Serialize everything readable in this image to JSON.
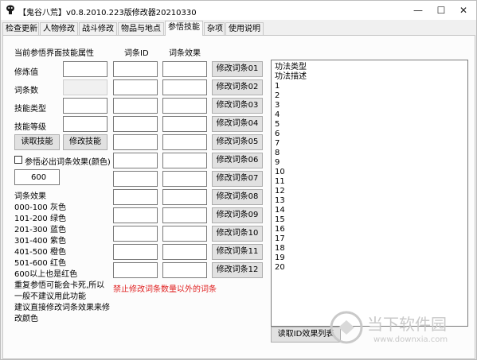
{
  "window": {
    "title": "【鬼谷八荒】v0.8.2010.223版修改器20210330",
    "minimize_glyph": "—",
    "maximize_glyph": "☐",
    "close_glyph": "✕",
    "icon": "app-icon"
  },
  "tabs": [
    {
      "label": "检查更新"
    },
    {
      "label": "人物修改"
    },
    {
      "label": "战斗修改"
    },
    {
      "label": "物品与地点"
    },
    {
      "label": "参悟技能"
    },
    {
      "label": "杂项"
    },
    {
      "label": "使用说明"
    }
  ],
  "active_tab": "参悟技能",
  "section": {
    "heading": "当前参悟界面技能属性",
    "col_id_header": "词条ID",
    "col_effect_header": "词条效果"
  },
  "fields": [
    {
      "label": "修炼值",
      "value": ""
    },
    {
      "label": "词条数",
      "value": ""
    },
    {
      "label": "技能类型",
      "value": ""
    },
    {
      "label": "技能等级",
      "value": ""
    }
  ],
  "buttons": {
    "read_skill": "读取技能",
    "modify_skill": "修改技能",
    "read_id_list": "读取ID效果列表"
  },
  "entry_buttons": [
    "修改词条01",
    "修改词条02",
    "修改词条03",
    "修改词条04",
    "修改词条05",
    "修改词条06",
    "修改词条07",
    "修改词条08",
    "修改词条09",
    "修改词条10",
    "修改词条11",
    "修改词条12"
  ],
  "checkbox": {
    "label": "参悟必出词条效果(颜色)",
    "checked": false
  },
  "effect_value": "600",
  "legend": {
    "title": "词条效果",
    "lines": [
      "000-100 灰色",
      "101-200 绿色",
      "201-300 蓝色",
      "301-400 紫色",
      "401-500 橙色",
      "501-600 红色",
      "600以上也是红色",
      "重复参悟可能会卡死,所以",
      "一般不建议用此功能",
      "建议直接修改词条效果来修",
      "改颜色"
    ]
  },
  "warning": "禁止修改词条数量以外的词条",
  "listbox": {
    "items": [
      "功法类型",
      "功法描述",
      "1",
      "2",
      "3",
      "4",
      "5",
      "6",
      "7",
      "8",
      "9",
      "10",
      "11",
      "12",
      "13",
      "14",
      "15",
      "16",
      "17",
      "18",
      "19",
      "20"
    ]
  },
  "watermark": {
    "cn": "当下软件园",
    "url": "www.downxia.com"
  }
}
